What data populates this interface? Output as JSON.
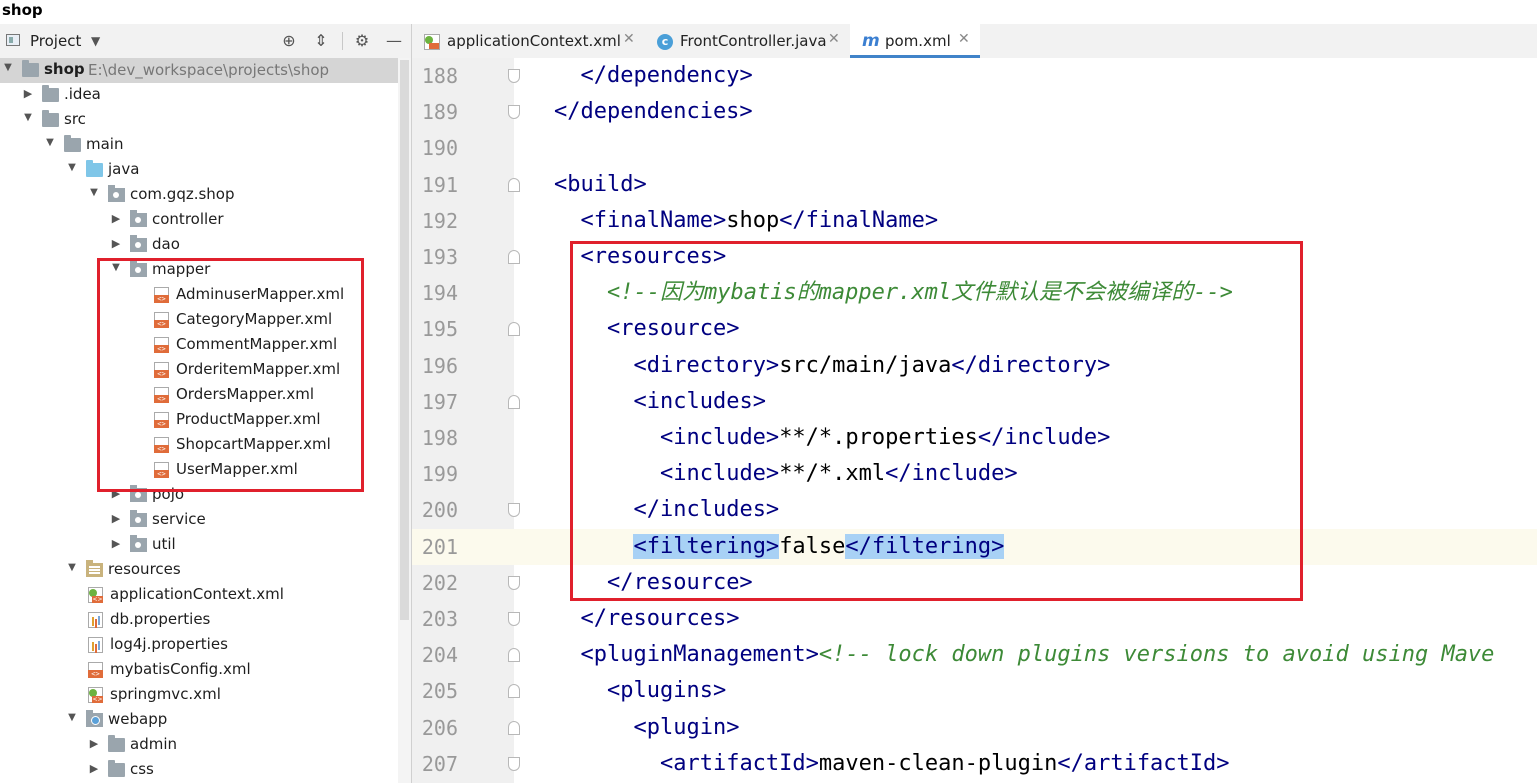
{
  "window": {
    "title": "shop"
  },
  "project_panel": {
    "title": "Project",
    "tree": [
      {
        "label": "shop",
        "path": "E:\\dev_workspace\\projects\\shop",
        "icon": "module-folder-icon",
        "expanded": true
      },
      {
        "label": ".idea",
        "icon": "folder-icon",
        "expanded": false
      },
      {
        "label": "src",
        "icon": "folder-icon",
        "expanded": true
      },
      {
        "label": "main",
        "icon": "folder-icon",
        "expanded": true
      },
      {
        "label": "java",
        "icon": "source-folder-icon",
        "expanded": true
      },
      {
        "label": "com.gqz.shop",
        "icon": "package-icon",
        "expanded": true
      },
      {
        "label": "controller",
        "icon": "package-icon",
        "expanded": false
      },
      {
        "label": "dao",
        "icon": "package-icon",
        "expanded": false
      },
      {
        "label": "mapper",
        "icon": "package-icon",
        "expanded": true
      },
      {
        "label": "AdminuserMapper.xml",
        "icon": "xml-file-icon"
      },
      {
        "label": "CategoryMapper.xml",
        "icon": "xml-file-icon"
      },
      {
        "label": "CommentMapper.xml",
        "icon": "xml-file-icon"
      },
      {
        "label": "OrderitemMapper.xml",
        "icon": "xml-file-icon"
      },
      {
        "label": "OrdersMapper.xml",
        "icon": "xml-file-icon"
      },
      {
        "label": "ProductMapper.xml",
        "icon": "xml-file-icon"
      },
      {
        "label": "ShopcartMapper.xml",
        "icon": "xml-file-icon"
      },
      {
        "label": "UserMapper.xml",
        "icon": "xml-file-icon"
      },
      {
        "label": "pojo",
        "icon": "package-icon",
        "expanded": false
      },
      {
        "label": "service",
        "icon": "package-icon",
        "expanded": false
      },
      {
        "label": "util",
        "icon": "package-icon",
        "expanded": false
      },
      {
        "label": "resources",
        "icon": "resources-folder-icon",
        "expanded": true
      },
      {
        "label": "applicationContext.xml",
        "icon": "spring-xml-file-icon"
      },
      {
        "label": "db.properties",
        "icon": "properties-file-icon"
      },
      {
        "label": "log4j.properties",
        "icon": "properties-file-icon"
      },
      {
        "label": "mybatisConfig.xml",
        "icon": "xml-file-icon"
      },
      {
        "label": "springmvc.xml",
        "icon": "spring-xml-file-icon"
      },
      {
        "label": "webapp",
        "icon": "web-folder-icon",
        "expanded": true
      },
      {
        "label": "admin",
        "icon": "folder-icon",
        "expanded": false
      },
      {
        "label": "css",
        "icon": "folder-icon",
        "expanded": false
      }
    ]
  },
  "editor": {
    "tabs": [
      {
        "label": "applicationContext.xml",
        "icon": "spring-xml-file-icon",
        "active": false
      },
      {
        "label": "FrontController.java",
        "icon": "java-class-icon",
        "active": false
      },
      {
        "label": "pom.xml",
        "icon": "maven-icon",
        "active": true
      }
    ],
    "lines": [
      {
        "num": "188",
        "code": "  </dependency>"
      },
      {
        "num": "189",
        "code": "</dependencies>"
      },
      {
        "num": "190",
        "code": ""
      },
      {
        "num": "191",
        "code": "<build>"
      },
      {
        "num": "192",
        "code": "  <finalName>shop</finalName>"
      },
      {
        "num": "193",
        "code": "  <resources>"
      },
      {
        "num": "194",
        "code": "    <!--因为mybatis的mapper.xml文件默认是不会被编译的-->"
      },
      {
        "num": "195",
        "code": "    <resource>"
      },
      {
        "num": "196",
        "code": "      <directory>src/main/java</directory>"
      },
      {
        "num": "197",
        "code": "      <includes>"
      },
      {
        "num": "198",
        "code": "        <include>**/*.properties</include>"
      },
      {
        "num": "199",
        "code": "        <include>**/*.xml</include>"
      },
      {
        "num": "200",
        "code": "      </includes>"
      },
      {
        "num": "201",
        "code": "      <filtering>false</filtering>"
      },
      {
        "num": "202",
        "code": "    </resource>"
      },
      {
        "num": "203",
        "code": "  </resources>"
      },
      {
        "num": "204",
        "code": "  <pluginManagement><!-- lock down plugins versions to avoid using Mave"
      },
      {
        "num": "205",
        "code": "    <plugins>"
      },
      {
        "num": "206",
        "code": "      <plugin>"
      },
      {
        "num": "207",
        "code": "        <artifactId>maven-clean-plugin</artifactId>"
      }
    ],
    "current_line": "201"
  },
  "colors": {
    "annotation_box": "#e0202c",
    "tag": "#000080",
    "comment": "#3d8a37",
    "highlight": "#a8d1f5",
    "active_tab_underline": "#4083c9"
  }
}
